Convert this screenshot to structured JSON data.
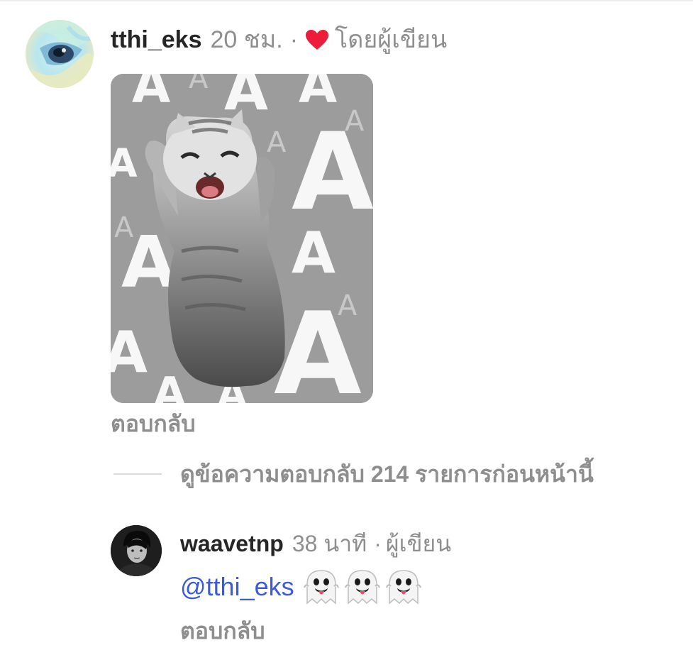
{
  "comment": {
    "username": "tthi_eks",
    "time": "20 ชม.",
    "separator": "·",
    "liked_by_author": "โดยผู้เขียน",
    "avatar": "abstract-eye-avatar",
    "sticker": {
      "type": "cat-sticker-gif",
      "background_letters": "A"
    },
    "reply_label": "ตอบกลับ"
  },
  "view_previous": {
    "label": "ดูข้อความตอบกลับ 214 รายการก่อนหน้านี้"
  },
  "reply": {
    "username": "waavetnp",
    "time": "38 นาที",
    "separator": "·",
    "author_badge": "ผู้เขียน",
    "avatar": "portrait-avatar",
    "mention": "@tthi_eks",
    "emojis": [
      "ghost-emoji",
      "ghost-emoji",
      "ghost-emoji"
    ],
    "reply_label": "ตอบกลับ"
  },
  "colors": {
    "heart": "#ed1c3a",
    "mention": "#3b5bdb",
    "secondary_text": "#8e8e8e",
    "primary_text": "#262626"
  }
}
